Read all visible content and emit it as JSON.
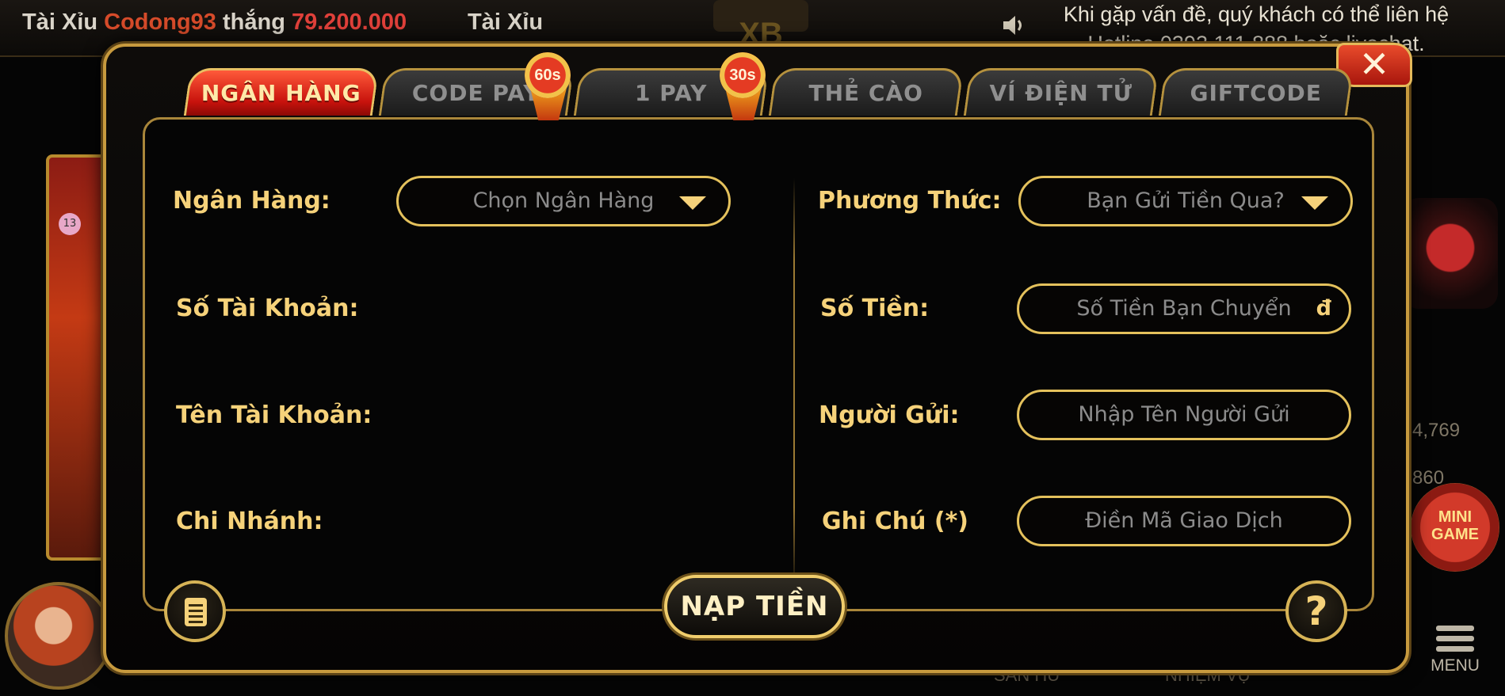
{
  "ticker": {
    "prefix": "Tài Xỉu",
    "player": "Codong93",
    "verb": "thắng",
    "amount": "79.200.000",
    "next": "Tài Xỉu"
  },
  "hotline": {
    "line1": "Khi gặp vấn đề, quý khách có thể liên hệ",
    "line2": "Hotline 0393.111.888 hoặc livechat."
  },
  "background": {
    "ball_number": "13",
    "side_numbers": [
      "4,769",
      "860"
    ],
    "bottom_labels": [
      "SĂN HŨ",
      "NHIỆM VỤ"
    ],
    "menu_label": "MENU",
    "minigame": [
      "MINI",
      "GAME"
    ]
  },
  "tabs": [
    {
      "label": "NGÂN HÀNG",
      "active": true
    },
    {
      "label": "CODE PAY",
      "badge": "60s"
    },
    {
      "label": "1 PAY",
      "badge": "30s"
    },
    {
      "label": "THẺ CÀO"
    },
    {
      "label": "VÍ ĐIỆN TỬ"
    },
    {
      "label": "GIFTCODE"
    }
  ],
  "left_form": {
    "bank_label": "Ngân Hàng:",
    "bank_select": "Chọn Ngân Hàng",
    "account_no_label": "Số Tài Khoản:",
    "account_name_label": "Tên Tài Khoản:",
    "branch_label": "Chi Nhánh:"
  },
  "right_form": {
    "method_label": "Phương Thức:",
    "method_select": "Bạn Gửi Tiền Qua?",
    "amount_label": "Số Tiền:",
    "amount_placeholder": "Số Tiền Bạn Chuyển",
    "currency": "đ",
    "sender_label": "Người Gửi:",
    "sender_placeholder": "Nhập Tên Người Gửi",
    "note_label": "Ghi Chú (*)",
    "note_placeholder": "Điền Mã Giao Dịch"
  },
  "actions": {
    "submit": "NẠP TIỀN",
    "help": "?"
  },
  "colors": {
    "gold": "#f6d27a",
    "active_tab": "#c7120c",
    "placeholder": "#8b8b8b"
  }
}
